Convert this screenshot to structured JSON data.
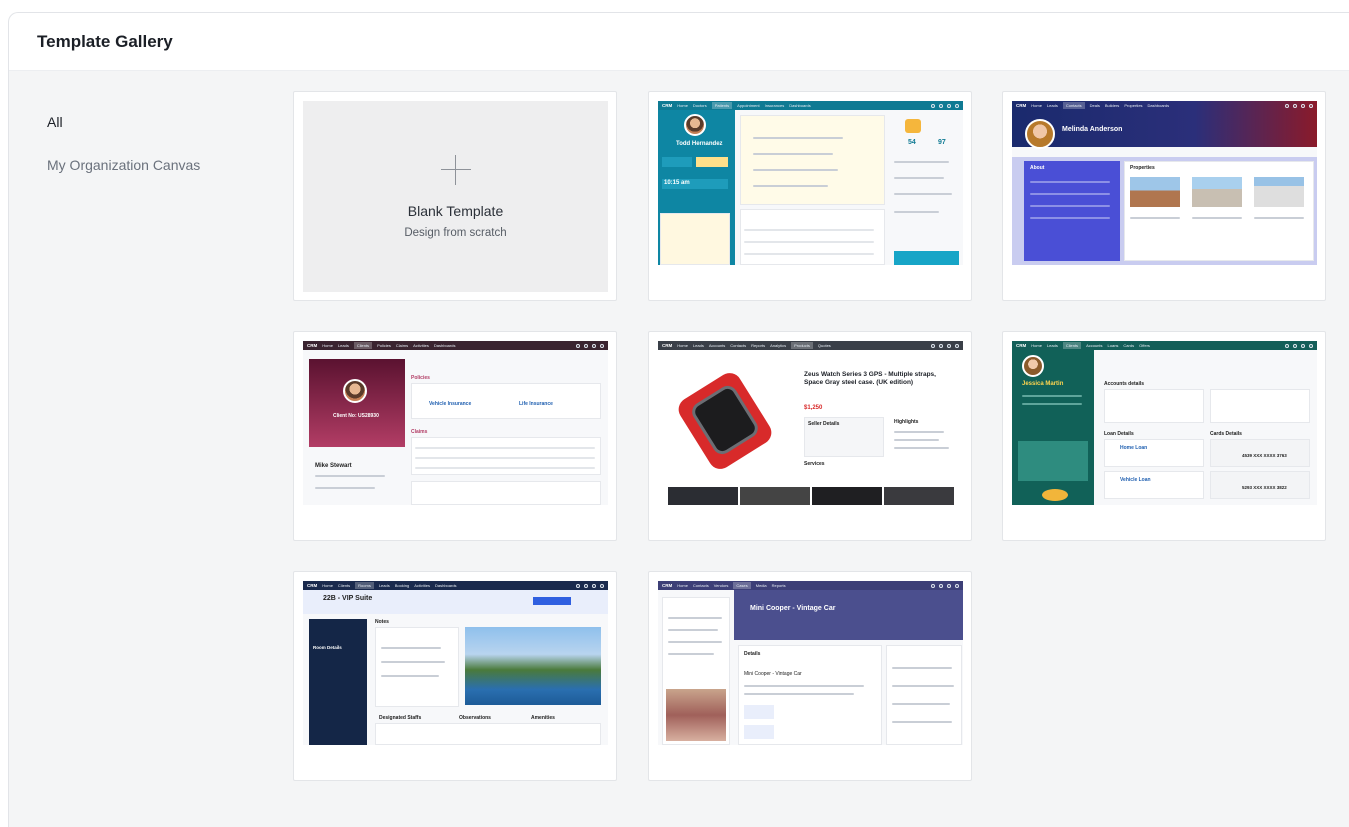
{
  "header": {
    "title": "Template Gallery"
  },
  "sidebar": {
    "items": [
      {
        "label": "All",
        "active": true
      },
      {
        "label": "My Organization Canvas",
        "active": false
      }
    ]
  },
  "blank": {
    "title": "Blank Template",
    "subtitle": "Design from scratch"
  },
  "thumbs": {
    "crm": "CRM",
    "t1": {
      "name": "Todd Hernandez",
      "time": "10:15 am",
      "stat1": "54",
      "stat2": "97"
    },
    "t2": {
      "name": "Melinda Anderson",
      "section": "Properties",
      "about": "About"
    },
    "t3": {
      "client": "Client No: US28930",
      "person": "Mike Stewart",
      "policies": "Policies",
      "claims": "Claims",
      "p1": "Vehicle Insurance",
      "p2": "Life Insurance"
    },
    "t4": {
      "title": "Zeus Watch Series 3 GPS - Multiple straps, Space Gray steel case. (UK edition)",
      "price": "$1,250",
      "seller": "Seller Details",
      "highlights": "Highlights",
      "services": "Services"
    },
    "t5": {
      "name": "Jessica Martin",
      "account": "Accounts details",
      "loan": "Loan Details",
      "cards": "Cards Details",
      "home": "Home Loan",
      "vehicle": "Vehicle Loan",
      "card1": "4539 XXX XXXX 3763",
      "card2": "5293 XXX XXXX 3822"
    },
    "t6": {
      "title": "22B - VIP Suite",
      "notes": "Notes",
      "room": "Room Details",
      "staff": "Designated Staffs",
      "obs": "Observations",
      "amen": "Amenities"
    },
    "t7": {
      "title": "Mini Cooper - Vintage Car",
      "details": "Details",
      "car": "Mini Cooper - Vintage Car"
    }
  },
  "colors": {
    "teal": "#0f7a93",
    "maroon": "#6b1b3c",
    "darkgray": "#3a3f48",
    "green": "#135e58",
    "navy": "#1a2a4d",
    "purple": "#3d3f77"
  }
}
